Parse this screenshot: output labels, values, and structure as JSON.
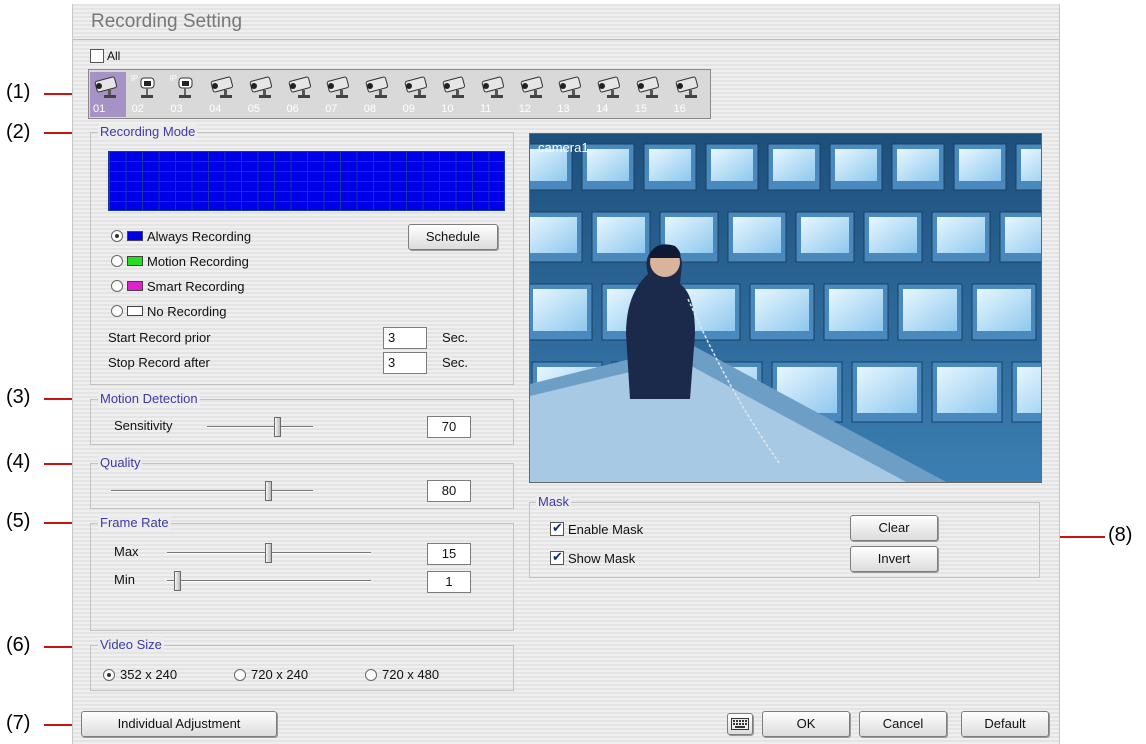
{
  "window": {
    "title": "Recording Setting"
  },
  "all_checkbox": {
    "label": "All",
    "checked": false
  },
  "cameras": [
    {
      "num": "01",
      "ip": false,
      "selected": true
    },
    {
      "num": "02",
      "ip": true,
      "selected": false
    },
    {
      "num": "03",
      "ip": true,
      "selected": false
    },
    {
      "num": "04",
      "ip": false,
      "selected": false
    },
    {
      "num": "05",
      "ip": false,
      "selected": false
    },
    {
      "num": "06",
      "ip": false,
      "selected": false
    },
    {
      "num": "07",
      "ip": false,
      "selected": false
    },
    {
      "num": "08",
      "ip": false,
      "selected": false
    },
    {
      "num": "09",
      "ip": false,
      "selected": false
    },
    {
      "num": "10",
      "ip": false,
      "selected": false
    },
    {
      "num": "11",
      "ip": false,
      "selected": false
    },
    {
      "num": "12",
      "ip": false,
      "selected": false
    },
    {
      "num": "13",
      "ip": false,
      "selected": false
    },
    {
      "num": "14",
      "ip": false,
      "selected": false
    },
    {
      "num": "15",
      "ip": false,
      "selected": false
    },
    {
      "num": "16",
      "ip": false,
      "selected": false
    }
  ],
  "ip_tag": "IP",
  "recording_mode": {
    "legend": "Recording Mode",
    "schedule_button": "Schedule",
    "options": [
      {
        "label": "Always Recording",
        "color": "#0000e8",
        "selected": true
      },
      {
        "label": "Motion Recording",
        "color": "#22dd22",
        "selected": false
      },
      {
        "label": "Smart Recording",
        "color": "#e020d0",
        "selected": false
      },
      {
        "label": "No Recording",
        "color": "#ffffff",
        "selected": false
      }
    ],
    "start_prior_label": "Start Record prior",
    "start_prior_value": "3",
    "stop_after_label": "Stop Record after",
    "stop_after_value": "3",
    "unit": "Sec."
  },
  "motion_detection": {
    "legend": "Motion Detection",
    "label": "Sensitivity",
    "value": "70"
  },
  "quality": {
    "legend": "Quality",
    "value": "80"
  },
  "frame_rate": {
    "legend": "Frame Rate",
    "max_label": "Max",
    "max_value": "15",
    "min_label": "Min",
    "min_value": "1"
  },
  "video_size": {
    "legend": "Video Size",
    "options": [
      {
        "label": "352 x 240",
        "selected": true
      },
      {
        "label": "720 x 240",
        "selected": false
      },
      {
        "label": "720 x 480",
        "selected": false
      }
    ]
  },
  "preview": {
    "camera_label": "camera1"
  },
  "mask": {
    "legend": "Mask",
    "enable_label": "Enable Mask",
    "enable_checked": true,
    "show_label": "Show Mask",
    "show_checked": true,
    "clear_button": "Clear",
    "invert_button": "Invert"
  },
  "buttons": {
    "individual": "Individual Adjustment",
    "ok": "OK",
    "cancel": "Cancel",
    "default": "Default"
  },
  "callouts": [
    "(1)",
    "(2)",
    "(3)",
    "(4)",
    "(5)",
    "(6)",
    "(7)",
    "(8)"
  ]
}
